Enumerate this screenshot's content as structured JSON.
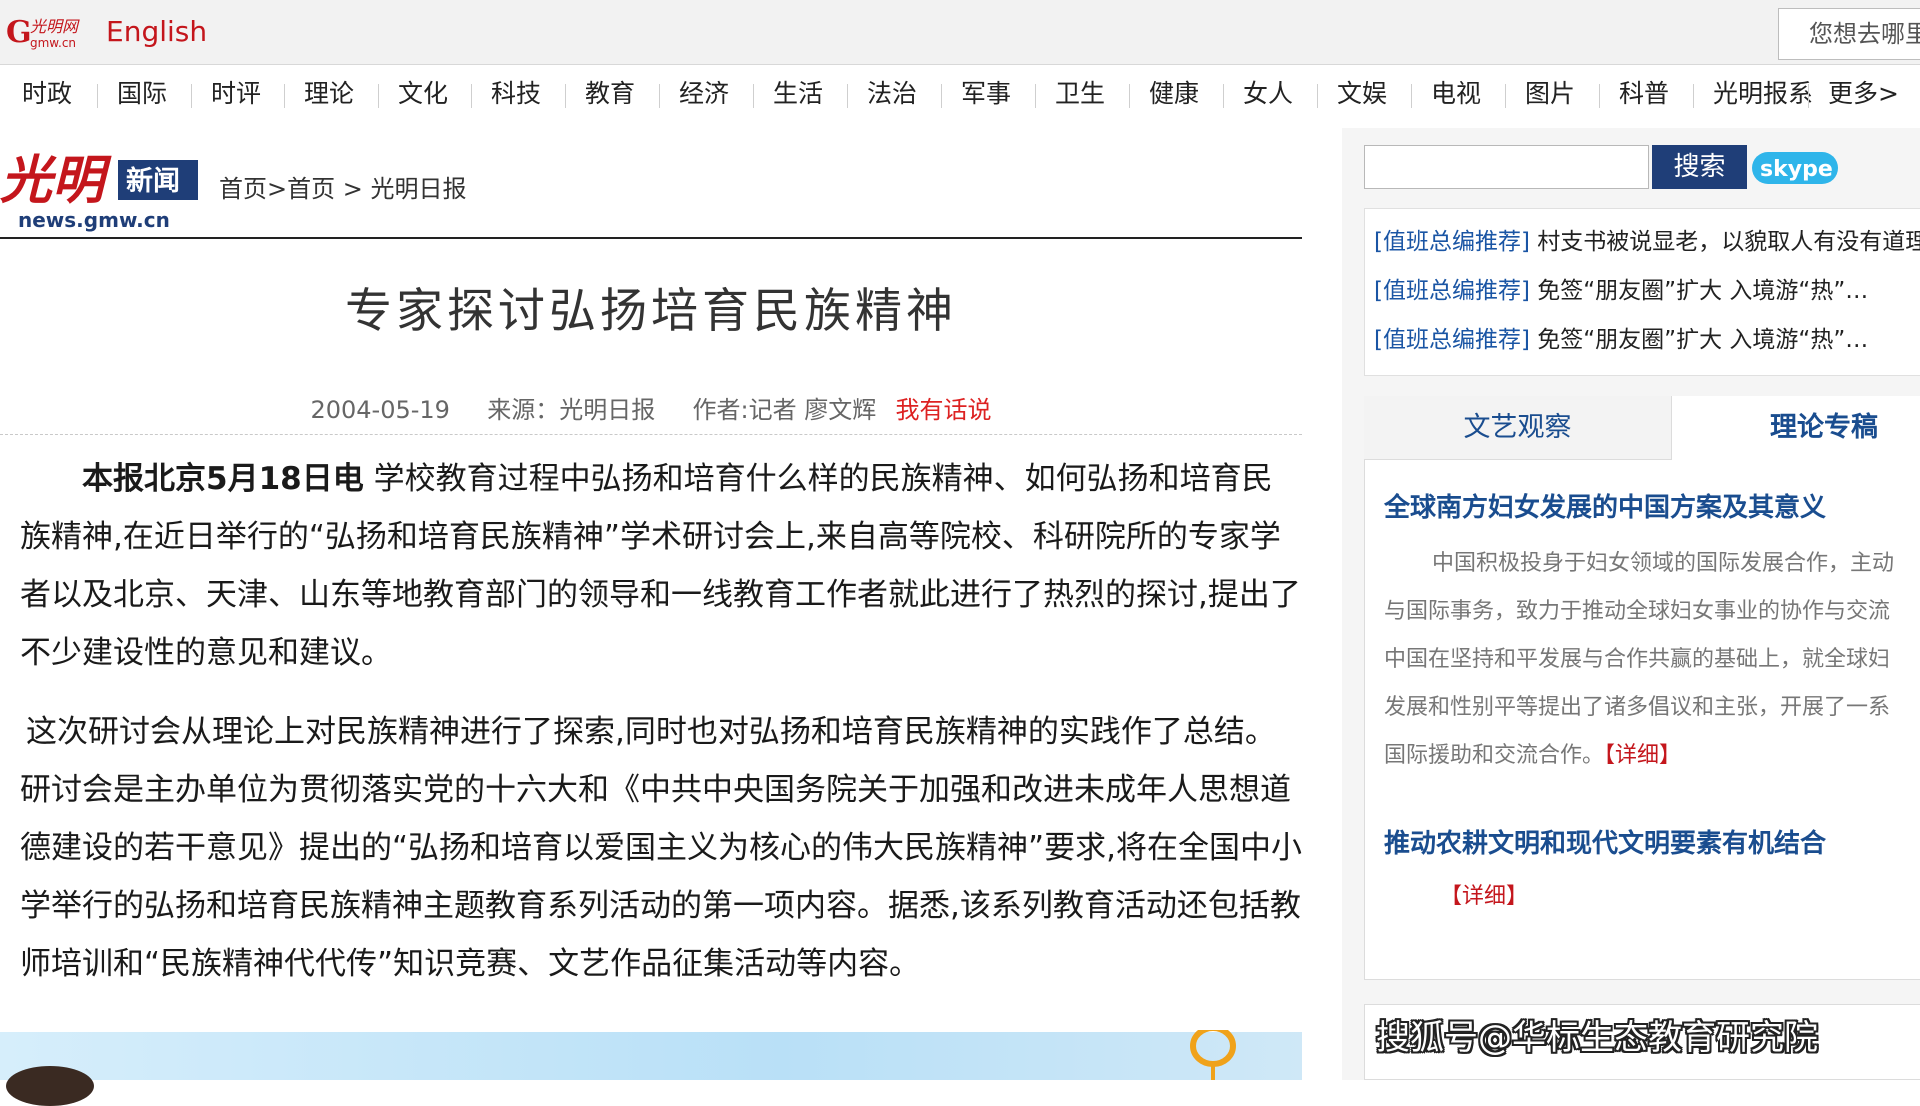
{
  "top_bar": {
    "logo_text": "光明网",
    "logo_sub": "gmw.cn",
    "english_link": "English",
    "where_placeholder": "您想去哪里"
  },
  "nav": {
    "items": [
      "时政",
      "国际",
      "时评",
      "理论",
      "文化",
      "科技",
      "教育",
      "经济",
      "生活",
      "法治",
      "军事",
      "卫生",
      "健康",
      "女人",
      "文娱",
      "电视",
      "图片",
      "科普",
      "光明报系",
      "更多>"
    ]
  },
  "brand": {
    "logo_text": "光明",
    "logo_badge": "新闻",
    "logo_url_text": "news.gmw.cn"
  },
  "breadcrumb": "首页>首页 > 光明日报",
  "article": {
    "title": "专家探讨弘扬培育民族精神",
    "date": "2004-05-19",
    "source": "来源：光明日报",
    "author": "作者:记者 廖文辉",
    "comment_link": "我有话说",
    "dateline": "本报北京5月18日电",
    "para1": "学校教育过程中弘扬和培育什么样的民族精神、如何弘扬和培育民族精神,在近日举行的“弘扬和培育民族精神”学术研讨会上,来自高等院校、科研院所的专家学者以及北京、天津、山东等地教育部门的领导和一线教育工作者就此进行了热烈的探讨,提出了不少建设性的意见和建议。",
    "para2": "这次研讨会从理论上对民族精神进行了探索,同时也对弘扬和培育民族精神的实践作了总结。研讨会是主办单位为贯彻落实党的十六大和《中共中央国务院关于加强和改进未成年人思想道德建设的若干意见》提出的“弘扬和培育以爱国主义为核心的伟大民族精神”要求,将在全国中小学举行的弘扬和培育民族精神主题教育系列活动的第一项内容。据悉,该系列教育活动还包括教师培训和“民族精神代代传”知识竞赛、文艺作品征集活动等内容。"
  },
  "sidebar": {
    "search_button": "搜索",
    "search_value": "",
    "skype_label": "skype",
    "recommend": [
      {
        "tag": "[值班总编推荐]",
        "text": "村支书被说显老，以貌取人有没有道理"
      },
      {
        "tag": "[值班总编推荐]",
        "text": "免签“朋友圈”扩大 入境游“热”…"
      },
      {
        "tag": "[值班总编推荐]",
        "text": "免签“朋友圈”扩大 入境游“热”…"
      }
    ],
    "tabs": [
      "文艺观察",
      "理论专稿"
    ],
    "article1_title": "全球南方妇女发展的中国方案及其意义",
    "article1_lines": [
      "中国积极投身于妇女领域的国际发展合作，主动",
      "与国际事务，致力于推动全球妇女事业的协作与交流",
      "中国在坚持和平发展与合作共赢的基础上，就全球妇",
      "发展和性别平等提出了诸多倡议和主张，开展了一系",
      "国际援助和交流合作。"
    ],
    "detail_label": "【详细】",
    "article2_title": "推动农耕文明和现代文明要素有机结合",
    "article2_detail": "【详细】"
  },
  "watermark": "搜狐号@华标生态教育研究院",
  "colors": {
    "brand_red": "#c4161c",
    "link_blue": "#1a55a4",
    "search_button": "#1f3e78"
  }
}
